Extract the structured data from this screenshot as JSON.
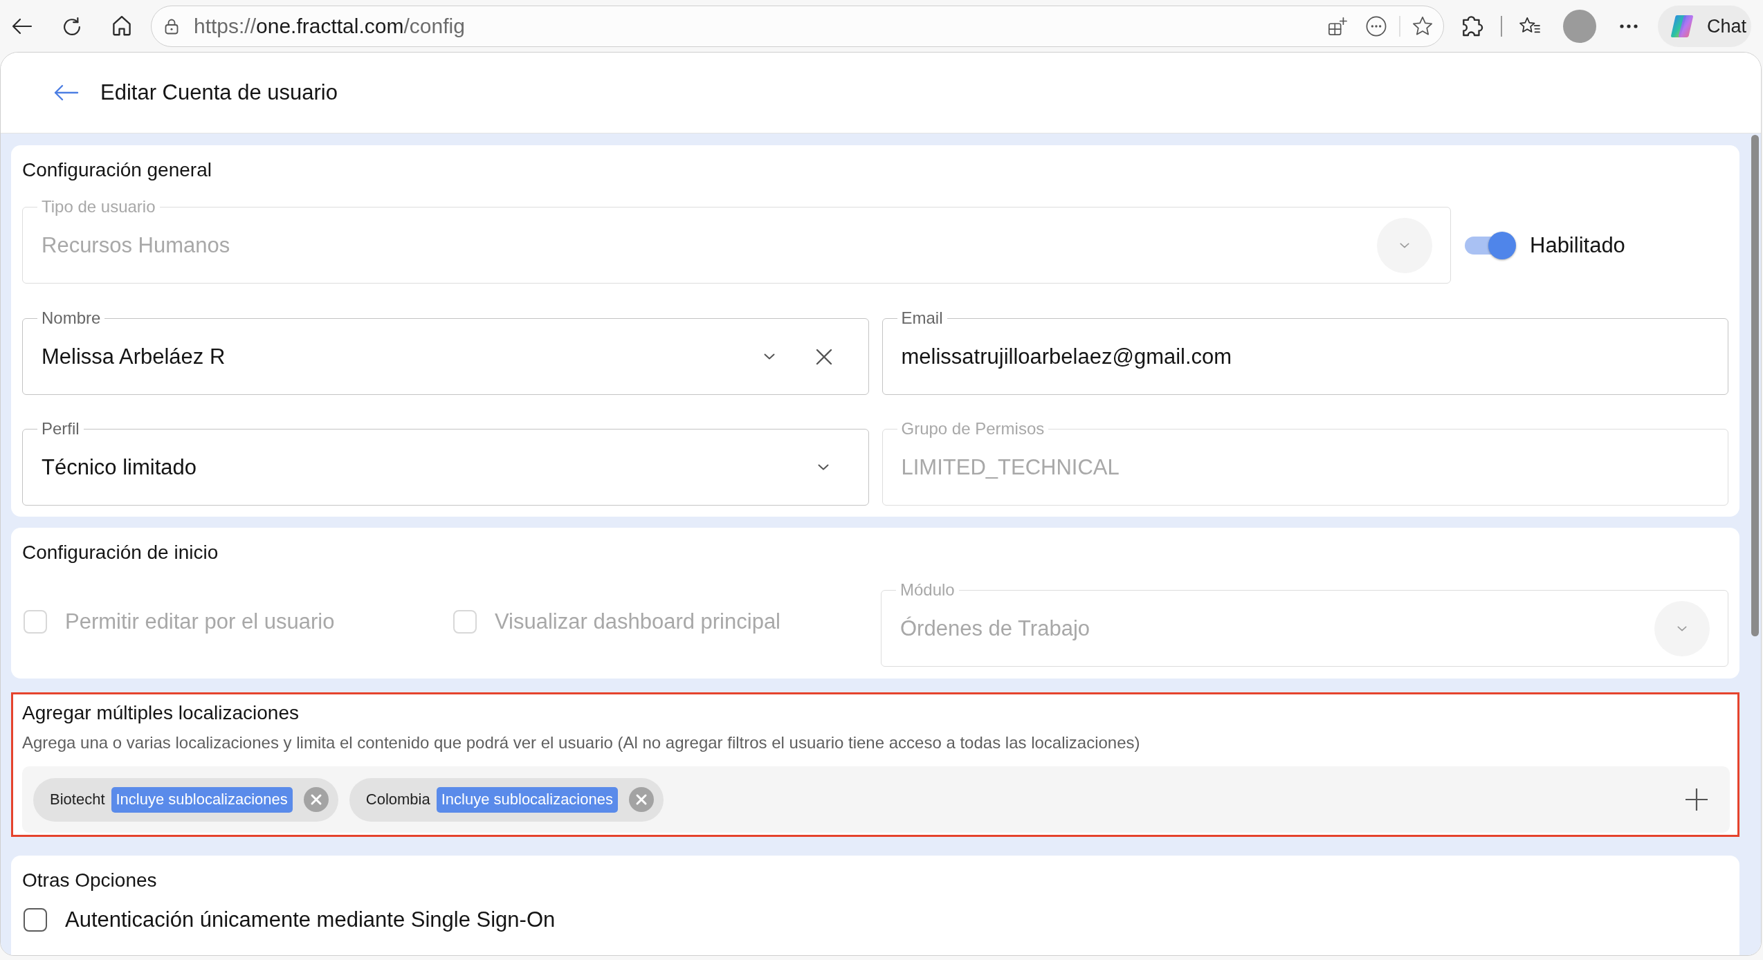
{
  "browser": {
    "url": {
      "scheme": "https://",
      "host": "one.fracttal.com",
      "path": "/config"
    },
    "chat_button": {
      "label": "Chat"
    }
  },
  "header": {
    "title": "Editar Cuenta de usuario"
  },
  "general": {
    "title": "Configuración general",
    "user_type": {
      "kind": "select",
      "label": "Tipo de usuario",
      "value": "Recursos Humanos",
      "disabled": true
    },
    "status_toggle": {
      "label": "Habilitado",
      "on": true
    },
    "fields": [
      {
        "kind": "select",
        "label": "Nombre",
        "value": "Melissa Arbeláez R",
        "disabled": false,
        "clearable": true
      },
      {
        "kind": "text",
        "label": "Email",
        "value": "melissatrujilloarbelaez@gmail.com",
        "disabled": false
      },
      {
        "kind": "select",
        "label": "Perfil",
        "value": "Técnico limitado",
        "disabled": false,
        "clearable": false
      },
      {
        "kind": "text",
        "label": "Grupo de Permisos",
        "value": "LIMITED_TECHNICAL",
        "disabled": true
      }
    ]
  },
  "start": {
    "title": "Configuración de inicio",
    "options": [
      {
        "label": "Permitir editar por el usuario",
        "checked": false,
        "disabled": true
      },
      {
        "label": "Visualizar dashboard principal",
        "checked": false,
        "disabled": true
      }
    ],
    "module": {
      "kind": "select",
      "label": "Módulo",
      "value": "Órdenes de Trabajo",
      "disabled": true
    }
  },
  "locations": {
    "title": "Agregar múltiples localizaciones",
    "description": "Agrega una o varias localizaciones y limita el contenido que podrá ver el usuario (Al no agregar filtros el usuario tiene acceso a todas las localizaciones)",
    "highlighted": true,
    "chips": [
      {
        "name": "Biotecht",
        "tag": "Incluye sublocalizaciones"
      },
      {
        "name": "Colombia",
        "tag": "Incluye sublocalizaciones"
      }
    ]
  },
  "other": {
    "title": "Otras Opciones",
    "options": [
      {
        "label": "Autenticación únicamente mediante Single Sign-On",
        "checked": false,
        "disabled": false
      }
    ]
  }
}
